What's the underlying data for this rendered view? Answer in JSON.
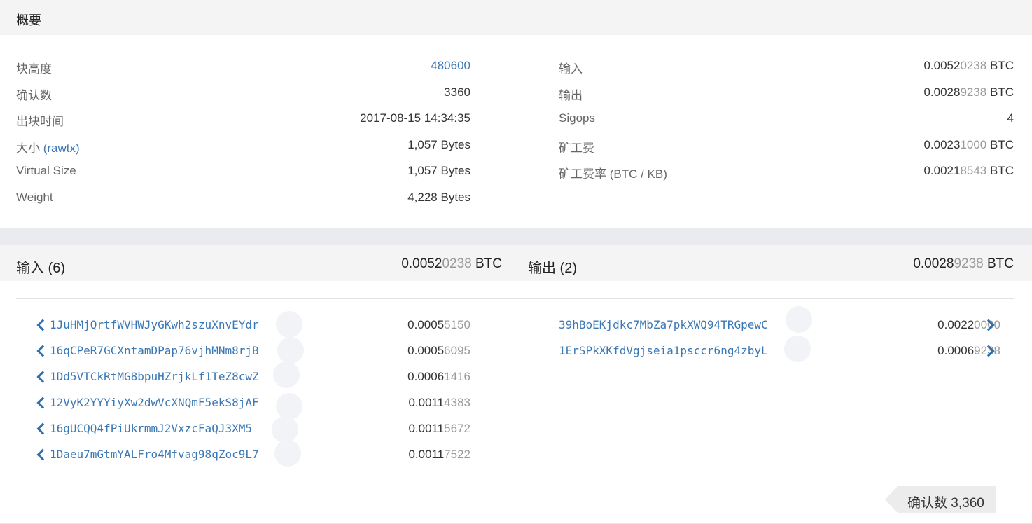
{
  "summary": {
    "title": "概要",
    "left_rows": [
      {
        "label": "块高度",
        "value": "480600"
      },
      {
        "label": "确认数",
        "value": "3360"
      },
      {
        "label": "出块时间",
        "value": "2017-08-15 14:34:35"
      },
      {
        "label_main": "大小 ",
        "label_link": "(rawtx)",
        "value": "1,057 Bytes"
      },
      {
        "label": "Virtual Size",
        "value": "1,057 Bytes"
      },
      {
        "label": "Weight",
        "value": "4,228 Bytes"
      }
    ],
    "right_rows": [
      {
        "label": "输入",
        "value_strong": "0.0052",
        "value_light": "0238",
        "unit": " BTC"
      },
      {
        "label": "输出",
        "value_strong": "0.0028",
        "value_light": "9238",
        "unit": " BTC"
      },
      {
        "label": "Sigops",
        "value": "4"
      },
      {
        "label": "矿工费",
        "value_strong": "0.0023",
        "value_light": "1000",
        "unit": " BTC"
      },
      {
        "label": "矿工费率 (BTC / KB)",
        "value_strong": "0.0021",
        "value_light": "8543",
        "unit": " BTC"
      }
    ]
  },
  "inputs": {
    "title": "输入 (6)",
    "total_strong": "0.0052",
    "total_light": "0238",
    "total_unit": " BTC",
    "items": [
      {
        "address": "1JuHMjQrtfWVHWJyGKwh2szuXnvEYdr",
        "amount_strong": "0.0005",
        "amount_light": "5150"
      },
      {
        "address": "16qCPeR7GCXntamDPap76vjhMNm8rjB",
        "amount_strong": "0.0005",
        "amount_light": "6095"
      },
      {
        "address": "1Dd5VTCkRtMG8bpuHZrjkLf1TeZ8cwZ",
        "amount_strong": "0.0006",
        "amount_light": "1416"
      },
      {
        "address": "12VyK2YYYiyXw2dwVcXNQmF5ekS8jAF",
        "amount_strong": "0.0011",
        "amount_light": "4383"
      },
      {
        "address": "16gUCQQ4fPiUkrmmJ2VxzcFaQJ3XM5",
        "amount_strong": "0.0011",
        "amount_light": "5672"
      },
      {
        "address": "1Daeu7mGtmYALFro4Mfvag98qZoc9L7",
        "amount_strong": "0.0011",
        "amount_light": "7522"
      }
    ]
  },
  "outputs": {
    "title": "输出 (2)",
    "total_strong": "0.0028",
    "total_light": "9238",
    "total_unit": " BTC",
    "items": [
      {
        "address": "39hBoEKjdkc7MbZa7pkXWQ94TRGpewC",
        "amount_strong": "0.0022",
        "amount_light": "0000"
      },
      {
        "address": "1ErSPkXKfdVgjseia1psccr6ng4zbyL",
        "amount_strong": "0.0006",
        "amount_light": "9238"
      }
    ]
  },
  "confirmations_badge": "确认数 3,360",
  "icons": {
    "input_arrow": "chevron-left-icon",
    "output_arrow": "chevron-right-icon"
  },
  "colors": {
    "link": "#3a78b5",
    "chevron": "#2e6fb0",
    "header_bg": "#f4f4f4"
  }
}
